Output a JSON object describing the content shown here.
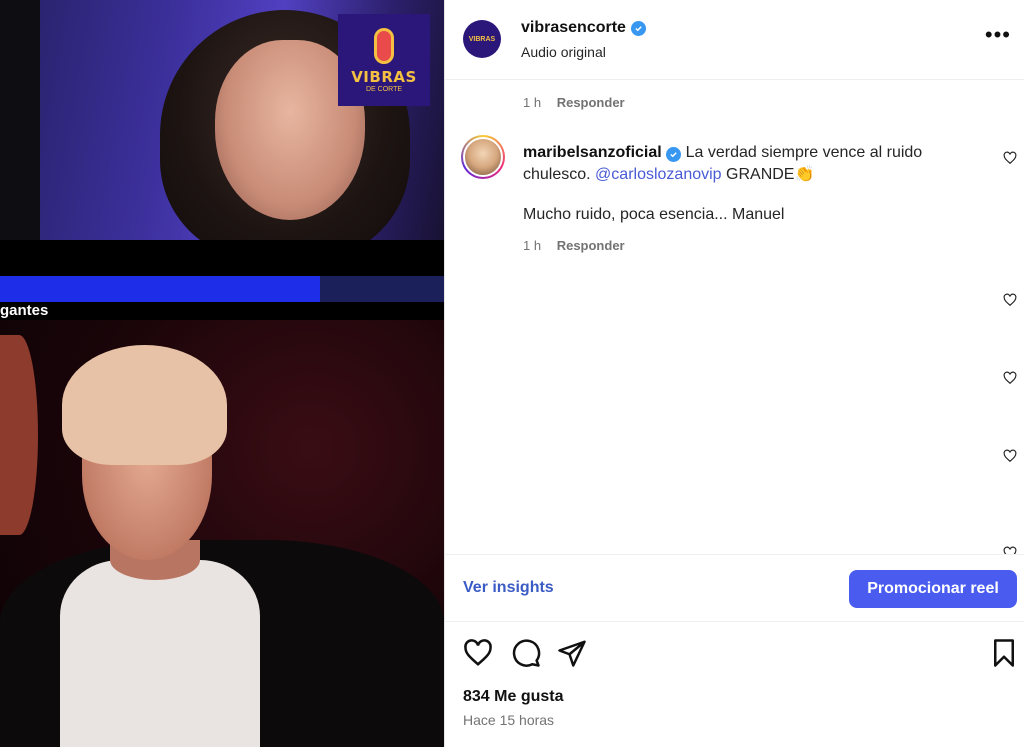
{
  "media": {
    "logo_line1": "VIBRAS",
    "logo_line2": "DE CORTE",
    "caption": "gantes"
  },
  "post": {
    "username": "vibrasencorte",
    "avatar_text": "VIBRAS",
    "audio_label": "Audio original",
    "more_label": "•••"
  },
  "comments": {
    "prev_meta": {
      "time": "1 h",
      "reply": "Responder"
    },
    "comment": {
      "username": "maribelsanzoficial",
      "text_before_mention": " La verdad siempre vence al ruido chulesco. ",
      "mention": "@carloslozanovip",
      "text_after_mention": " GRANDE",
      "emoji": "👏",
      "second_line": "Mucho ruido, poca esencia... Manuel",
      "time": "1 h",
      "reply": "Responder"
    }
  },
  "actions": {
    "insights_label": "Ver insights",
    "promote_label": "Promocionar reel"
  },
  "footer": {
    "likes": "834 Me gusta",
    "time_ago": "Hace 15 horas"
  },
  "colors": {
    "accent": "#4a5cf0",
    "link": "#3b5bc5",
    "verified": "#3897f0"
  },
  "icons": [
    "heart-icon",
    "comment-icon",
    "share-icon",
    "bookmark-icon",
    "verified-icon",
    "more-icon"
  ]
}
